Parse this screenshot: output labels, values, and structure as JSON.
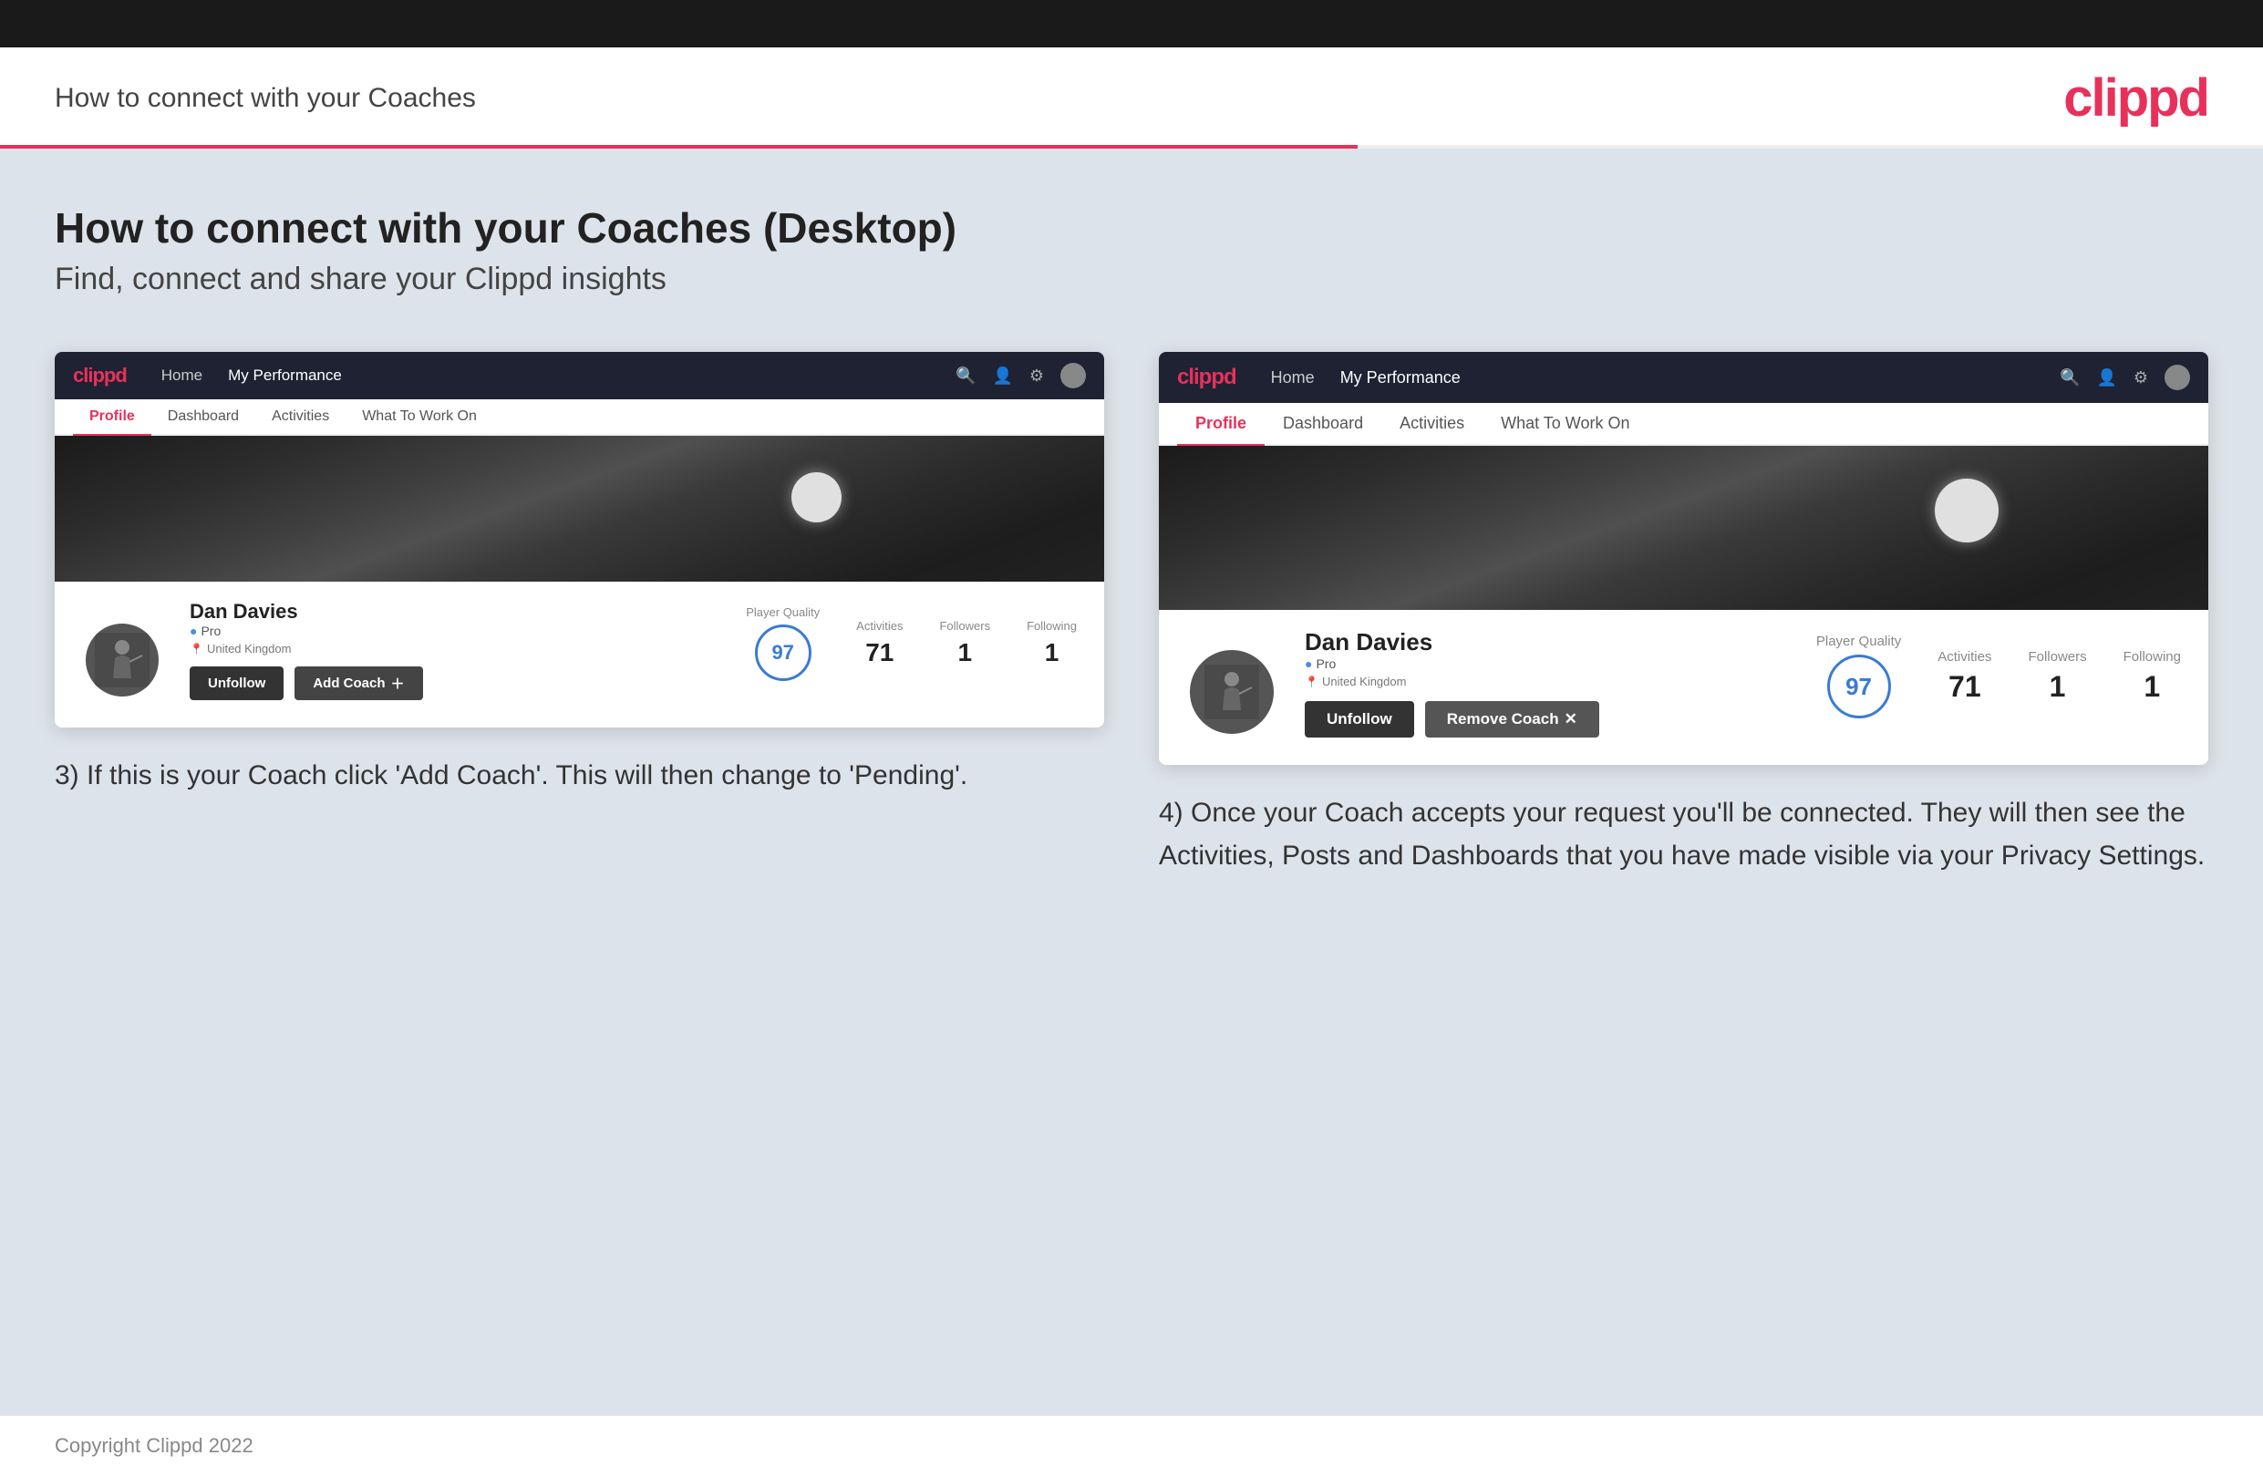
{
  "topbar": {},
  "header": {
    "title": "How to connect with your Coaches",
    "logo": "clippd"
  },
  "main": {
    "section_title": "How to connect with your Coaches (Desktop)",
    "section_subtitle": "Find, connect and share your Clippd insights",
    "left_mockup": {
      "nav": {
        "logo": "clippd",
        "links": [
          "Home",
          "My Performance"
        ],
        "icons": [
          "search",
          "user",
          "bell",
          "avatar"
        ]
      },
      "tabs": [
        "Profile",
        "Dashboard",
        "Activities",
        "What To Work On"
      ],
      "active_tab": "Profile",
      "user": {
        "name": "Dan Davies",
        "badge": "Pro",
        "location": "United Kingdom",
        "player_quality": 97,
        "activities": 71,
        "followers": 1,
        "following": 1
      },
      "buttons": [
        "Unfollow",
        "Add Coach"
      ]
    },
    "right_mockup": {
      "nav": {
        "logo": "clippd",
        "links": [
          "Home",
          "My Performance"
        ],
        "icons": [
          "search",
          "user",
          "bell",
          "avatar"
        ]
      },
      "tabs": [
        "Profile",
        "Dashboard",
        "Activities",
        "What To Work On"
      ],
      "active_tab": "Profile",
      "user": {
        "name": "Dan Davies",
        "badge": "Pro",
        "location": "United Kingdom",
        "player_quality": 97,
        "activities": 71,
        "followers": 1,
        "following": 1
      },
      "buttons": [
        "Unfollow",
        "Remove Coach"
      ]
    },
    "left_caption": "3) If this is your Coach click 'Add Coach'. This will then change to 'Pending'.",
    "right_caption": "4) Once your Coach accepts your request you'll be connected. They will then see the Activities, Posts and Dashboards that you have made visible via your Privacy Settings."
  },
  "footer": {
    "copyright": "Copyright Clippd 2022"
  }
}
